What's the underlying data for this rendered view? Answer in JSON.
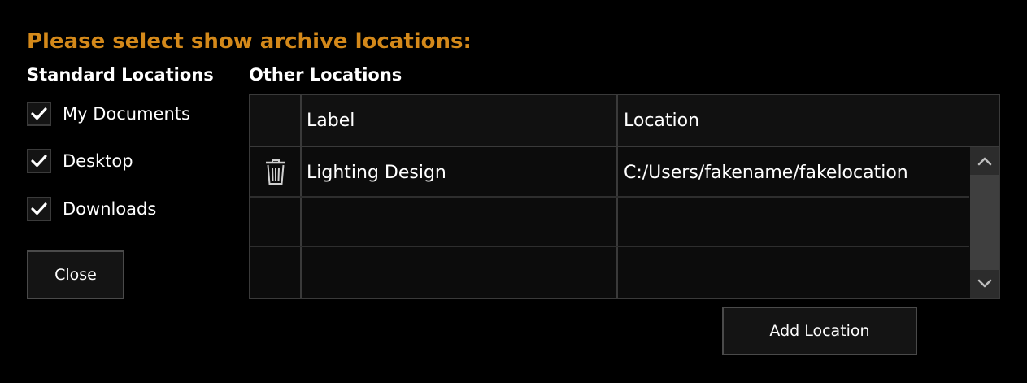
{
  "dialog": {
    "title": "Please select show archive locations:",
    "accent_color": "#d4891a"
  },
  "standard_locations": {
    "heading": "Standard Locations",
    "items": [
      {
        "label": "My Documents",
        "checked": true
      },
      {
        "label": "Desktop",
        "checked": true
      },
      {
        "label": "Downloads",
        "checked": true
      }
    ]
  },
  "other_locations": {
    "heading": "Other Locations",
    "columns": [
      "",
      "Label",
      "Location"
    ],
    "rows": [
      {
        "icon": "trash-icon",
        "label": "Lighting Design",
        "location": "C:/Users/fakename/fakelocation"
      },
      {
        "icon": "",
        "label": "",
        "location": ""
      },
      {
        "icon": "",
        "label": "",
        "location": ""
      }
    ]
  },
  "buttons": {
    "close": "Close",
    "add_location": "Add Location"
  },
  "icons": {
    "checkbox": "check-icon",
    "delete": "trash-icon",
    "scroll_up": "chevron-up-icon",
    "scroll_down": "chevron-down-icon"
  }
}
